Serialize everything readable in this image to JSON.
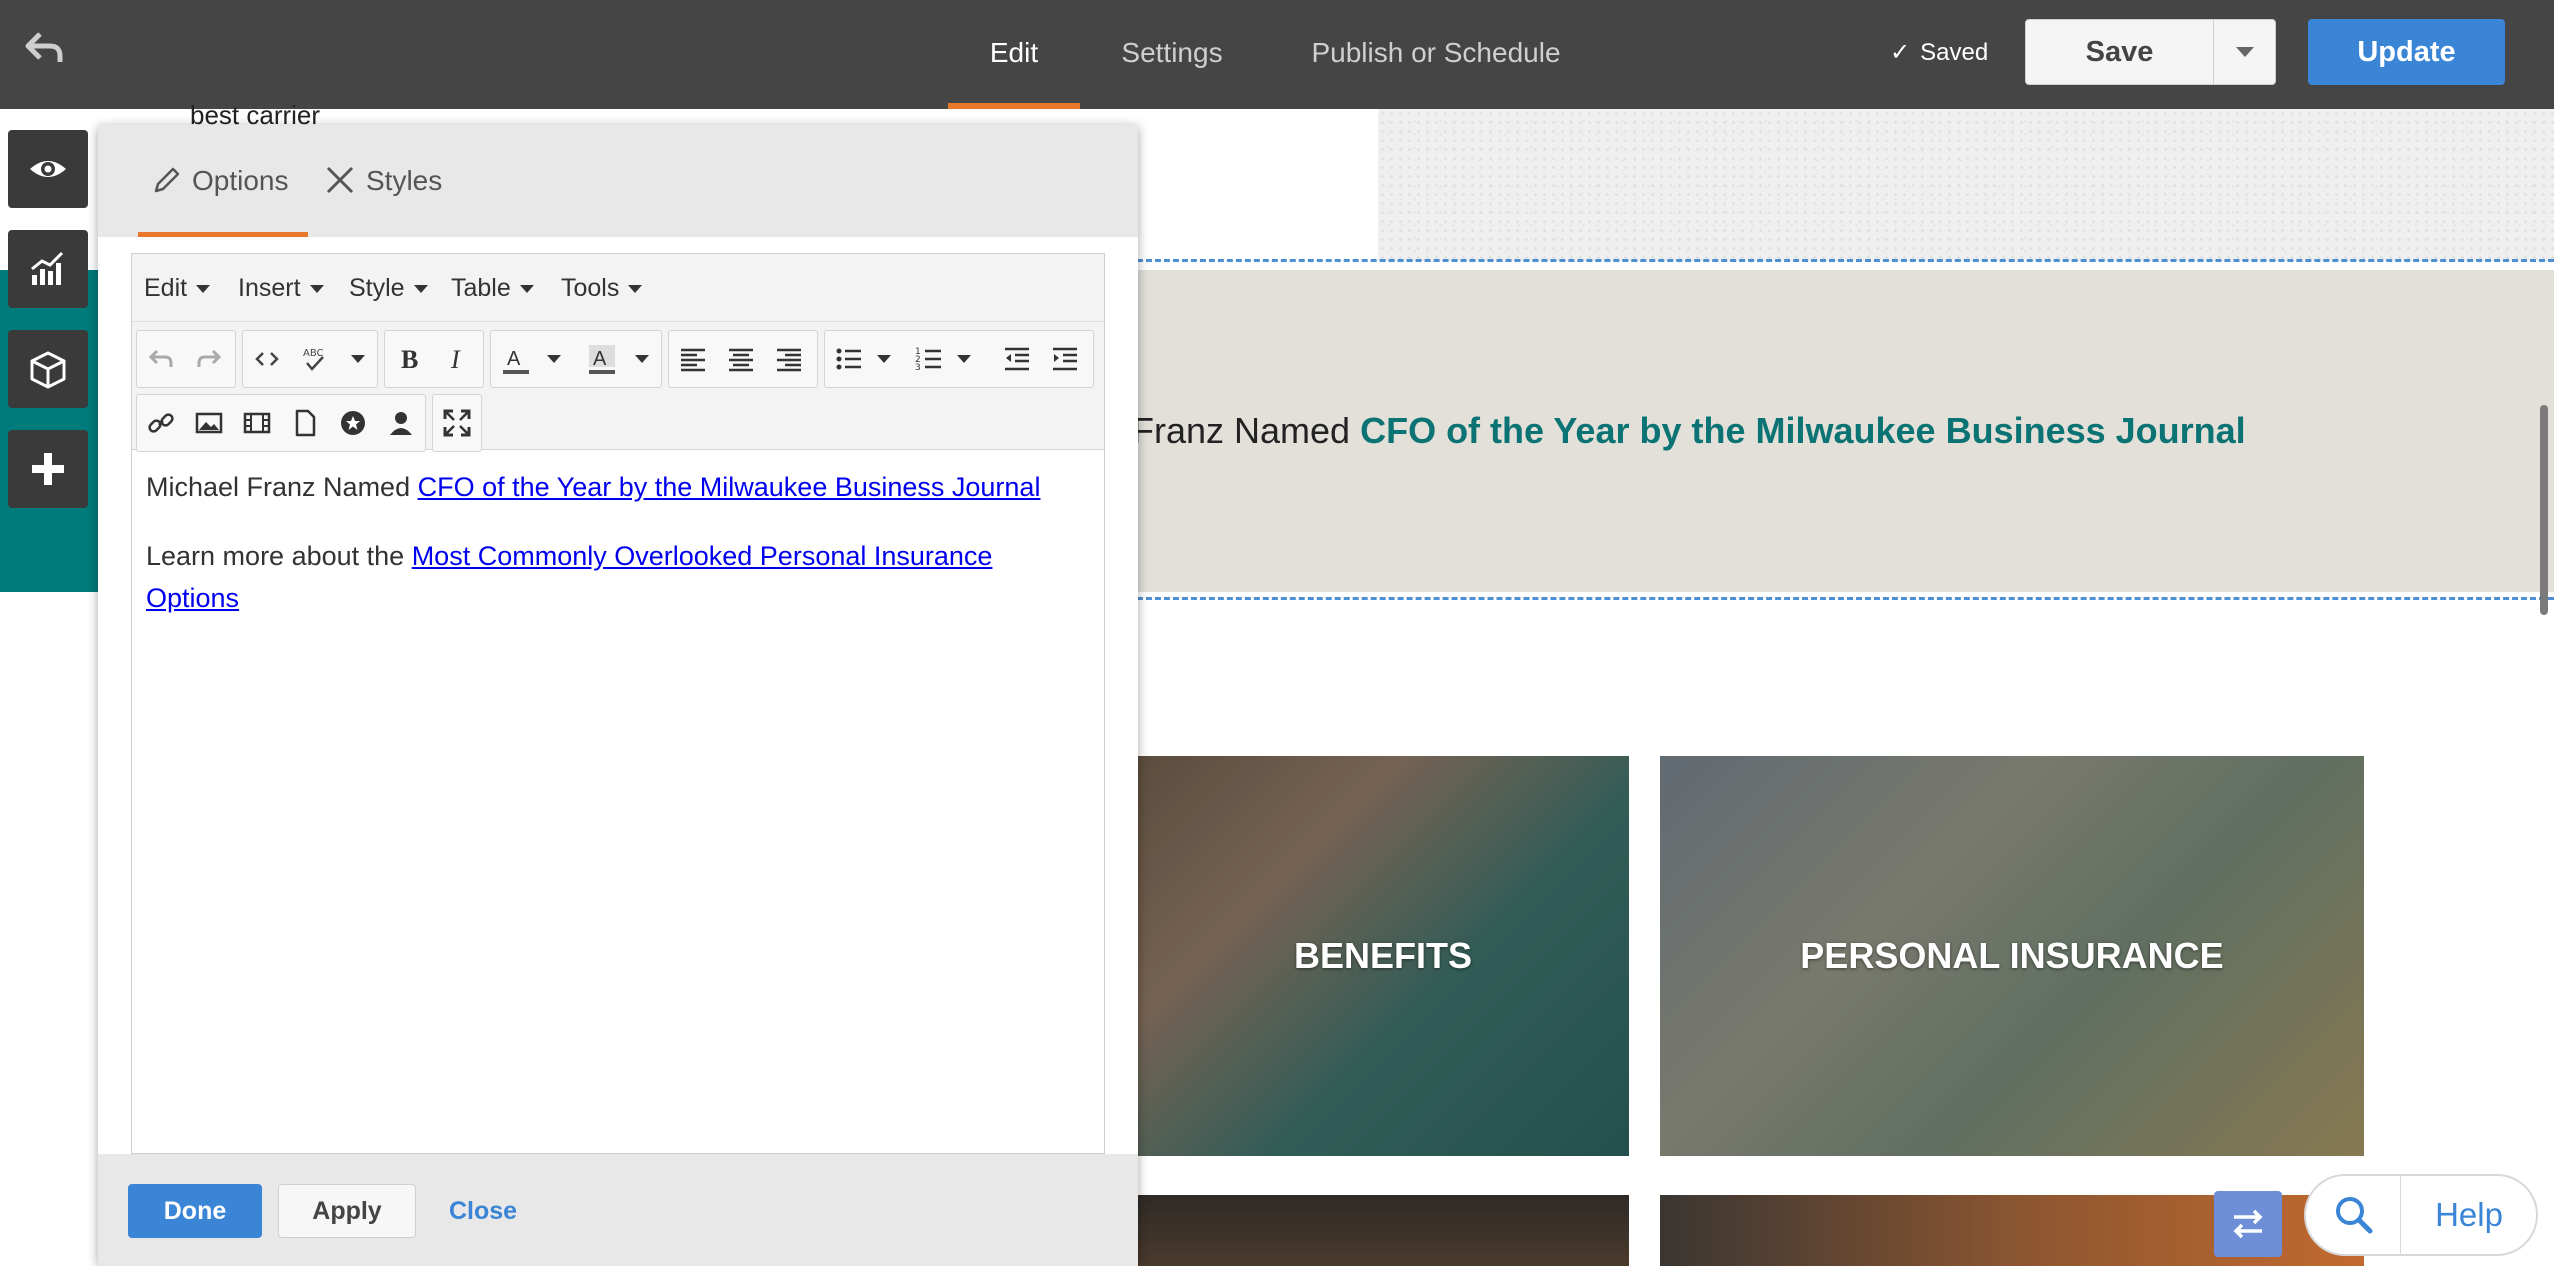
{
  "topbar": {
    "tabs": [
      {
        "label": "Edit",
        "active": true
      },
      {
        "label": "Settings",
        "active": false
      },
      {
        "label": "Publish or Schedule",
        "active": false
      }
    ],
    "saved_status": "Saved",
    "save_label": "Save",
    "update_label": "Update"
  },
  "page": {
    "carrier_text": "best carrier",
    "banner_prefix": "Franz Named ",
    "banner_link": "CFO of the Year by the Milwaukee Business Journal",
    "tiles": [
      {
        "label": "BENEFITS"
      },
      {
        "label": "PERSONAL INSURANCE"
      }
    ]
  },
  "rail": {
    "icons": [
      "eye-icon",
      "analytics-chart-icon",
      "cube-icon",
      "plus-icon"
    ]
  },
  "editor": {
    "tabs": [
      {
        "label": "Options",
        "icon": "pencil-icon",
        "active": true
      },
      {
        "label": "Styles",
        "icon": "styles-tools-icon",
        "active": false
      }
    ],
    "menubar": [
      "Edit",
      "Insert",
      "Style",
      "Table",
      "Tools"
    ],
    "content": {
      "p1_text": "Michael Franz Named ",
      "p1_link": "CFO of the Year by the Milwaukee Business Journal",
      "p2_text": "Learn more about the ",
      "p2_link": "Most Commonly Overlooked Personal Insurance Options"
    },
    "footer": {
      "done_label": "Done",
      "apply_label": "Apply",
      "close_label": "Close"
    }
  },
  "help": {
    "label": "Help"
  },
  "colors": {
    "topbar_bg": "#454545",
    "accent_orange": "#e8782c",
    "primary_blue": "#3a85d6",
    "teal": "#007b7b",
    "banner_bg": "#e2e0d9"
  }
}
